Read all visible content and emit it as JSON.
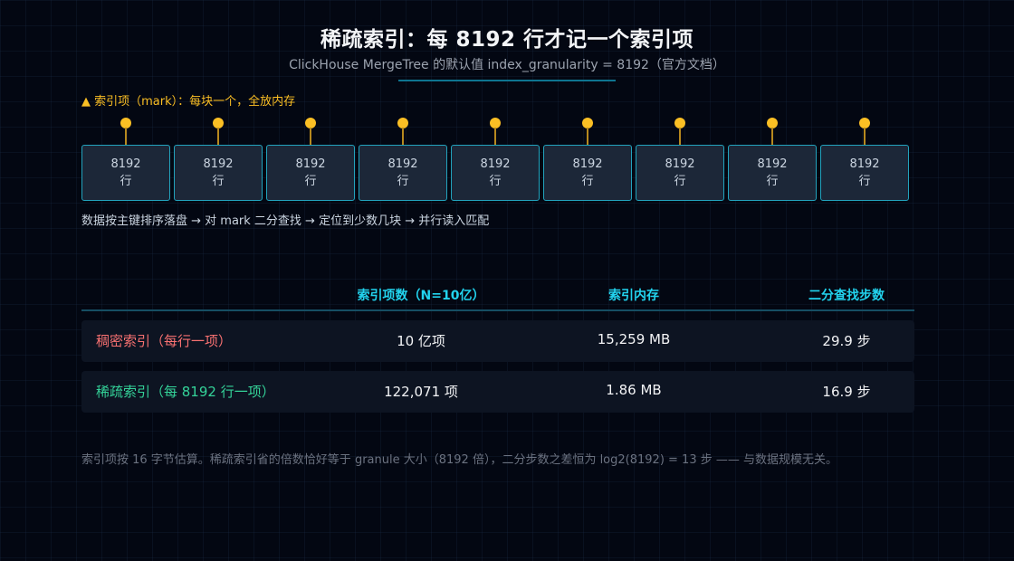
{
  "header": {
    "title": "稀疏索引：每 8192 行才记一个索引项",
    "subtitle": "ClickHouse MergeTree 的默认值 index_granularity = 8192（官方文档）"
  },
  "diagram": {
    "marker_legend": "▲ 索引项（mark）：每块一个，全放内存",
    "granules": [
      {
        "rows": "8192",
        "unit": "行"
      },
      {
        "rows": "8192",
        "unit": "行"
      },
      {
        "rows": "8192",
        "unit": "行"
      },
      {
        "rows": "8192",
        "unit": "行"
      },
      {
        "rows": "8192",
        "unit": "行"
      },
      {
        "rows": "8192",
        "unit": "行"
      },
      {
        "rows": "8192",
        "unit": "行"
      },
      {
        "rows": "8192",
        "unit": "行"
      },
      {
        "rows": "8192",
        "unit": "行"
      }
    ],
    "flow_text": "数据按主键排序落盘 → 对 mark 二分查找 → 定位到少数几块 → 并行读入匹配"
  },
  "comparison": {
    "headers": [
      "",
      "索引项数（N=10亿）",
      "索引内存",
      "二分查找步数"
    ],
    "rows": [
      {
        "name": "稠密索引（每行一项）",
        "entries": "10 亿项",
        "memory": "15,259 MB",
        "steps": "29.9 步",
        "color": "#f87171"
      },
      {
        "name": "稀疏索引（每 8192 行一项）",
        "entries": "122,071 项",
        "memory": "1.86 MB",
        "steps": "16.9 步",
        "color": "#34d399"
      }
    ]
  },
  "footnote": "索引项按 16 字节估算。稀疏索引省的倍数恰好等于 granule 大小（8192 倍），二分步数之差恒为 log2(8192) = 13 步 —— 与数据规模无关。",
  "colors": {
    "accent": "#22d3ee",
    "mark": "#fbbf24",
    "dense": "#f87171",
    "sparse": "#34d399"
  }
}
